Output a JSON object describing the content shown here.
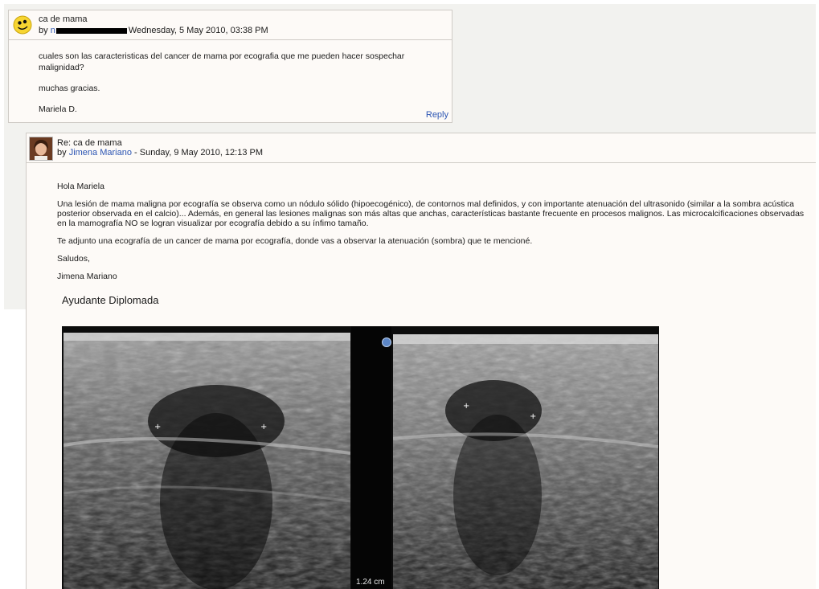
{
  "post1": {
    "subject": "ca de mama",
    "by_prefix": "by ",
    "author_visible_fragment": "n",
    "date": "Wednesday, 5 May 2010, 03:38 PM",
    "paragraphs": [
      "cuales son las caracteristicas del cancer de mama por ecografia que me pueden hacer sospechar malignidad?",
      "muchas gracias.",
      "Mariela  D."
    ],
    "reply_label": "Reply",
    "avatar_icon": "smiley-icon"
  },
  "post2": {
    "subject": "Re: ca de mama",
    "by_prefix": "by ",
    "author": "Jimena Mariano",
    "date_separator": " - ",
    "date": "Sunday, 9 May 2010, 12:13 PM",
    "paragraphs": [
      "Hola Mariela",
      "Una lesión de mama maligna por ecografía se observa como un nódulo sólido (hipoecogénico), de contornos mal definidos, y con importante atenuación del ultrasonido (similar a la sombra acústica posterior observada en el calcio)... Además, en general las lesiones malignas son más altas que anchas, características bastante frecuente en procesos malignos. Las microcalcificaciones observadas en la mamografía NO se logran visualizar por ecografía debido a su ínfimo tamaño.",
      "Te adjunto una ecografía de un cancer de mama por ecografía, donde vas a observar la atenuación (sombra) que te mencioné.",
      "Saludos,",
      "Jimena Mariano"
    ],
    "signature": "Ayudante Diplomada",
    "ultrasound": {
      "scale_label": "1.24 cm"
    }
  },
  "colors": {
    "link": "#2c55b3",
    "post_bg": "#fdfaf7",
    "border": "#cfcbc6"
  }
}
